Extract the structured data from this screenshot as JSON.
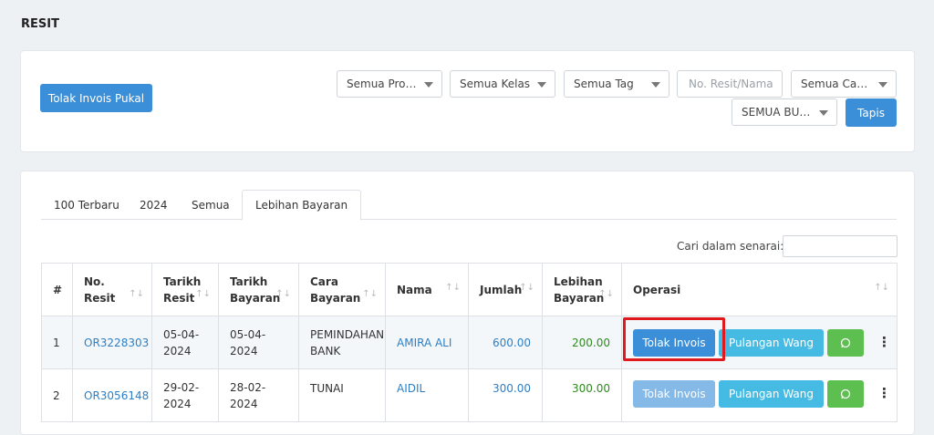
{
  "page": {
    "title": "RESIT"
  },
  "filters": {
    "bulk_reject_label": "Tolak Invois Pukal",
    "program_select": "Semua Progra...",
    "class_select": "Semua Kelas",
    "tag_select": "Semua Tag",
    "search_placeholder": "No. Resit/Nama",
    "payment_method_select": "Semua Cara ...",
    "month_select": "SEMUA BULAN",
    "filter_button": "Tapis"
  },
  "tabs": [
    {
      "label": "100 Terbaru",
      "active": false
    },
    {
      "label": "2024",
      "active": false
    },
    {
      "label": "Semua",
      "active": false
    },
    {
      "label": "Lebihan Bayaran",
      "active": true
    }
  ],
  "search": {
    "label": "Cari dalam senarai:"
  },
  "table": {
    "headers": {
      "index": "#",
      "receipt_no": [
        "No.",
        "Resit"
      ],
      "receipt_date": [
        "Tarikh",
        "Resit"
      ],
      "payment_date": [
        "Tarikh",
        "Bayaran"
      ],
      "payment_method": [
        "Cara",
        "Bayaran"
      ],
      "name": "Nama",
      "amount": "Jumlah",
      "overpayment": [
        "Lebihan",
        "Bayaran"
      ],
      "operations": "Operasi"
    },
    "sort_glyph": "↑↓",
    "rows": [
      {
        "index": "1",
        "receipt_no": "OR3228303",
        "receipt_date": [
          "05-04-",
          "2024"
        ],
        "payment_date": [
          "05-04-",
          "2024"
        ],
        "payment_method": [
          "PEMINDAHAN",
          "BANK"
        ],
        "name": "AMIRA ALI",
        "amount": "600.00",
        "overpayment": "200.00"
      },
      {
        "index": "2",
        "receipt_no": "OR3056148",
        "receipt_date": [
          "29-02-",
          "2024"
        ],
        "payment_date": [
          "28-02-",
          "2024"
        ],
        "payment_method": [
          "TUNAI"
        ],
        "name": "AIDIL",
        "amount": "300.00",
        "overpayment": "300.00"
      }
    ],
    "actions": {
      "reject_invoice": "Tolak Invois",
      "refund": "Pulangan Wang",
      "whatsapp_icon": "whatsapp-icon",
      "more_icon": "kebab-icon"
    }
  },
  "colors": {
    "primary": "#3a8fd8",
    "info": "#45bbe3",
    "success": "#5cbf4f",
    "link": "#2e7fc4",
    "highlight": "#e0191c"
  }
}
